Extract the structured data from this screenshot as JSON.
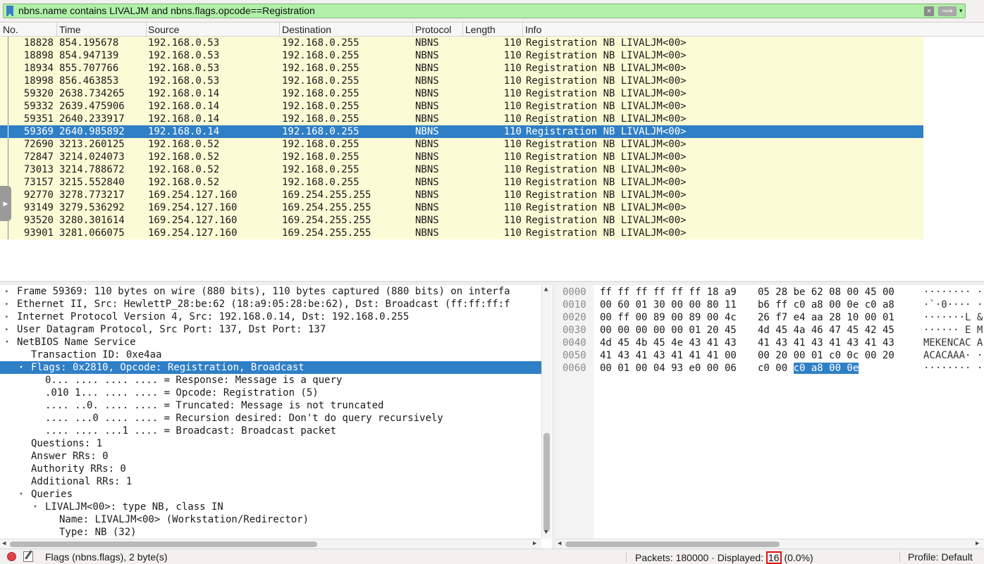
{
  "filter": {
    "text": "nbns.name contains LIVALJM and nbns.flags.opcode==Registration",
    "clear_icon": "×",
    "apply_icon": "⟹",
    "dropdown_icon": "▾"
  },
  "packet_list": {
    "columns": [
      "No.",
      "Time",
      "Source",
      "Destination",
      "Protocol",
      "Length",
      "Info"
    ],
    "rows": [
      {
        "no": "18828",
        "time": "854.195678",
        "src": "192.168.0.53",
        "dst": "192.168.0.255",
        "proto": "NBNS",
        "len": "110",
        "info": "Registration NB LIVALJM<00>"
      },
      {
        "no": "18898",
        "time": "854.947139",
        "src": "192.168.0.53",
        "dst": "192.168.0.255",
        "proto": "NBNS",
        "len": "110",
        "info": "Registration NB LIVALJM<00>"
      },
      {
        "no": "18934",
        "time": "855.707766",
        "src": "192.168.0.53",
        "dst": "192.168.0.255",
        "proto": "NBNS",
        "len": "110",
        "info": "Registration NB LIVALJM<00>"
      },
      {
        "no": "18998",
        "time": "856.463853",
        "src": "192.168.0.53",
        "dst": "192.168.0.255",
        "proto": "NBNS",
        "len": "110",
        "info": "Registration NB LIVALJM<00>"
      },
      {
        "no": "59320",
        "time": "2638.734265",
        "src": "192.168.0.14",
        "dst": "192.168.0.255",
        "proto": "NBNS",
        "len": "110",
        "info": "Registration NB LIVALJM<00>"
      },
      {
        "no": "59332",
        "time": "2639.475906",
        "src": "192.168.0.14",
        "dst": "192.168.0.255",
        "proto": "NBNS",
        "len": "110",
        "info": "Registration NB LIVALJM<00>"
      },
      {
        "no": "59351",
        "time": "2640.233917",
        "src": "192.168.0.14",
        "dst": "192.168.0.255",
        "proto": "NBNS",
        "len": "110",
        "info": "Registration NB LIVALJM<00>"
      },
      {
        "no": "59369",
        "time": "2640.985892",
        "src": "192.168.0.14",
        "dst": "192.168.0.255",
        "proto": "NBNS",
        "len": "110",
        "info": "Registration NB LIVALJM<00>",
        "selected": true
      },
      {
        "no": "72690",
        "time": "3213.260125",
        "src": "192.168.0.52",
        "dst": "192.168.0.255",
        "proto": "NBNS",
        "len": "110",
        "info": "Registration NB LIVALJM<00>"
      },
      {
        "no": "72847",
        "time": "3214.024073",
        "src": "192.168.0.52",
        "dst": "192.168.0.255",
        "proto": "NBNS",
        "len": "110",
        "info": "Registration NB LIVALJM<00>"
      },
      {
        "no": "73013",
        "time": "3214.788672",
        "src": "192.168.0.52",
        "dst": "192.168.0.255",
        "proto": "NBNS",
        "len": "110",
        "info": "Registration NB LIVALJM<00>"
      },
      {
        "no": "73157",
        "time": "3215.552840",
        "src": "192.168.0.52",
        "dst": "192.168.0.255",
        "proto": "NBNS",
        "len": "110",
        "info": "Registration NB LIVALJM<00>"
      },
      {
        "no": "92770",
        "time": "3278.773217",
        "src": "169.254.127.160",
        "dst": "169.254.255.255",
        "proto": "NBNS",
        "len": "110",
        "info": "Registration NB LIVALJM<00>"
      },
      {
        "no": "93149",
        "time": "3279.536292",
        "src": "169.254.127.160",
        "dst": "169.254.255.255",
        "proto": "NBNS",
        "len": "110",
        "info": "Registration NB LIVALJM<00>"
      },
      {
        "no": "93520",
        "time": "3280.301614",
        "src": "169.254.127.160",
        "dst": "169.254.255.255",
        "proto": "NBNS",
        "len": "110",
        "info": "Registration NB LIVALJM<00>"
      },
      {
        "no": "93901",
        "time": "3281.066075",
        "src": "169.254.127.160",
        "dst": "169.254.255.255",
        "proto": "NBNS",
        "len": "110",
        "info": "Registration NB LIVALJM<00>"
      }
    ]
  },
  "details": {
    "lines": [
      {
        "indent": 0,
        "expander": "collapsed",
        "text": "Frame 59369: 110 bytes on wire (880 bits), 110 bytes captured (880 bits) on interfa"
      },
      {
        "indent": 0,
        "expander": "collapsed",
        "text": "Ethernet II, Src: HewlettP_28:be:62 (18:a9:05:28:be:62), Dst: Broadcast (ff:ff:ff:f"
      },
      {
        "indent": 0,
        "expander": "collapsed",
        "text": "Internet Protocol Version 4, Src: 192.168.0.14, Dst: 192.168.0.255"
      },
      {
        "indent": 0,
        "expander": "collapsed",
        "text": "User Datagram Protocol, Src Port: 137, Dst Port: 137"
      },
      {
        "indent": 0,
        "expander": "expanded",
        "text": "NetBIOS Name Service"
      },
      {
        "indent": 1,
        "expander": "none",
        "text": "Transaction ID: 0xe4aa"
      },
      {
        "indent": 1,
        "expander": "expanded",
        "text": "Flags: 0x2810, Opcode: Registration, Broadcast",
        "selected": true
      },
      {
        "indent": 2,
        "expander": "none",
        "text": "0... .... .... .... = Response: Message is a query"
      },
      {
        "indent": 2,
        "expander": "none",
        "text": ".010 1... .... .... = Opcode: Registration (5)"
      },
      {
        "indent": 2,
        "expander": "none",
        "text": ".... ..0. .... .... = Truncated: Message is not truncated"
      },
      {
        "indent": 2,
        "expander": "none",
        "text": ".... ...0 .... .... = Recursion desired: Don't do query recursively"
      },
      {
        "indent": 2,
        "expander": "none",
        "text": ".... .... ...1 .... = Broadcast: Broadcast packet"
      },
      {
        "indent": 1,
        "expander": "none",
        "text": "Questions: 1"
      },
      {
        "indent": 1,
        "expander": "none",
        "text": "Answer RRs: 0"
      },
      {
        "indent": 1,
        "expander": "none",
        "text": "Authority RRs: 0"
      },
      {
        "indent": 1,
        "expander": "none",
        "text": "Additional RRs: 1"
      },
      {
        "indent": 1,
        "expander": "expanded",
        "text": "Queries"
      },
      {
        "indent": 2,
        "expander": "expanded",
        "text": "LIVALJM<00>: type NB, class IN"
      },
      {
        "indent": 3,
        "expander": "none",
        "text": "Name: LIVALJM<00> (Workstation/Redirector)"
      },
      {
        "indent": 3,
        "expander": "none",
        "text": "Type: NB (32)"
      }
    ]
  },
  "bytes": {
    "rows": [
      {
        "offset": "0000",
        "hex1": "ff ff ff ff ff ff 18 a9",
        "hex2": "05 28 be 62 08 00 45 00",
        "ascii": "········ ·"
      },
      {
        "offset": "0010",
        "hex1": "00 60 01 30 00 00 80 11",
        "hex2": "b6 ff c0 a8 00 0e c0 a8",
        "ascii": "·`·0···· ·"
      },
      {
        "offset": "0020",
        "hex1": "00 ff 00 89 00 89 00 4c",
        "hex2": "26 f7 e4 aa 28 10 00 01",
        "ascii": "·······L &"
      },
      {
        "offset": "0030",
        "hex1": "00 00 00 00 00 01 20 45",
        "hex2": "4d 45 4a 46 47 45 42 45",
        "ascii": "······ E M"
      },
      {
        "offset": "0040",
        "hex1": "4d 45 4b 45 4e 43 41 43",
        "hex2": "41 43 41 43 41 43 41 43",
        "ascii": "MEKENCAC A"
      },
      {
        "offset": "0050",
        "hex1": "41 43 41 43 41 41 41 00",
        "hex2": "00 20 00 01 c0 0c 00 20",
        "ascii": "ACACAAA· ·"
      },
      {
        "offset": "0060",
        "hex1": "00 01 00 04 93 e0 00 06",
        "hex2": "c0 00 ",
        "hex2_hl": "c0 a8 00 0e",
        "ascii": "········ ·"
      }
    ]
  },
  "status": {
    "field": "Flags (nbns.flags), 2 byte(s)",
    "packets_prefix": "Packets: 180000 · Displayed: ",
    "displayed": "16",
    "displayed_suffix": " (0.0%)",
    "profile": "Profile: Default"
  },
  "icons": {
    "expanded": "▾",
    "collapsed": "▸",
    "sidebar_handle": "▶",
    "scroll_up": "▲",
    "scroll_down": "▼",
    "scroll_left": "◀",
    "scroll_right": "▶"
  },
  "colors": {
    "filter_valid": "#b0f0a8",
    "row_bg": "#fbfbd6",
    "selection": "#2f7fc6",
    "capture_stopped": "#e0424a"
  }
}
